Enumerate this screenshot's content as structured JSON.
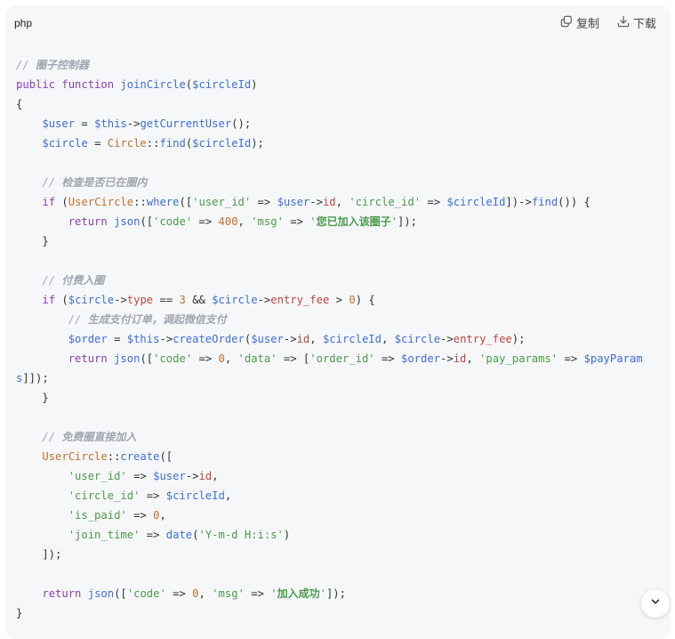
{
  "header": {
    "language": "php",
    "copy_label": "复制",
    "download_label": "下载"
  },
  "code": {
    "lines": [
      [
        [
          "cm",
          "// "
        ],
        [
          "czh",
          "圈子控制器"
        ]
      ],
      [
        [
          "kw",
          "public function "
        ],
        [
          "fn",
          "joinCircle"
        ],
        [
          "pl",
          "("
        ],
        [
          "vr",
          "$circleId"
        ],
        [
          "pl",
          ")"
        ]
      ],
      [
        [
          "pl",
          "{"
        ]
      ],
      [
        [
          "pl",
          "    "
        ],
        [
          "vr",
          "$user"
        ],
        [
          "pl",
          " = "
        ],
        [
          "vr",
          "$this"
        ],
        [
          "pl",
          "->"
        ],
        [
          "fn",
          "getCurrentUser"
        ],
        [
          "pl",
          "();"
        ]
      ],
      [
        [
          "pl",
          "    "
        ],
        [
          "vr",
          "$circle"
        ],
        [
          "pl",
          " = "
        ],
        [
          "cl",
          "Circle"
        ],
        [
          "pl",
          "::"
        ],
        [
          "fn",
          "find"
        ],
        [
          "pl",
          "("
        ],
        [
          "vr",
          "$circleId"
        ],
        [
          "pl",
          ");"
        ]
      ],
      [],
      [
        [
          "pl",
          "    "
        ],
        [
          "cm",
          "// "
        ],
        [
          "czh",
          "检查是否已在圈内"
        ]
      ],
      [
        [
          "pl",
          "    "
        ],
        [
          "kw",
          "if"
        ],
        [
          "pl",
          " ("
        ],
        [
          "cl",
          "UserCircle"
        ],
        [
          "pl",
          "::"
        ],
        [
          "fn",
          "where"
        ],
        [
          "pl",
          "(["
        ],
        [
          "st",
          "'user_id'"
        ],
        [
          "pl",
          " => "
        ],
        [
          "vr",
          "$user"
        ],
        [
          "pl",
          "->"
        ],
        [
          "pr",
          "id"
        ],
        [
          "pl",
          ", "
        ],
        [
          "st",
          "'circle_id'"
        ],
        [
          "pl",
          " => "
        ],
        [
          "vr",
          "$circleId"
        ],
        [
          "pl",
          "])->"
        ],
        [
          "fn",
          "find"
        ],
        [
          "pl",
          "()) {"
        ]
      ],
      [
        [
          "pl",
          "        "
        ],
        [
          "kw",
          "return "
        ],
        [
          "fn",
          "json"
        ],
        [
          "pl",
          "(["
        ],
        [
          "st",
          "'code'"
        ],
        [
          "pl",
          " => "
        ],
        [
          "nm",
          "400"
        ],
        [
          "pl",
          ", "
        ],
        [
          "st",
          "'msg'"
        ],
        [
          "pl",
          " => "
        ],
        [
          "st",
          "'"
        ],
        [
          "zh",
          "您已加入该圈子"
        ],
        [
          "st",
          "'"
        ],
        [
          "pl",
          "]);"
        ]
      ],
      [
        [
          "pl",
          "    }"
        ]
      ],
      [],
      [
        [
          "pl",
          "    "
        ],
        [
          "cm",
          "// "
        ],
        [
          "czh",
          "付费入圈"
        ]
      ],
      [
        [
          "pl",
          "    "
        ],
        [
          "kw",
          "if"
        ],
        [
          "pl",
          " ("
        ],
        [
          "vr",
          "$circle"
        ],
        [
          "pl",
          "->"
        ],
        [
          "pr",
          "type"
        ],
        [
          "pl",
          " == "
        ],
        [
          "nm",
          "3"
        ],
        [
          "pl",
          " && "
        ],
        [
          "vr",
          "$circle"
        ],
        [
          "pl",
          "->"
        ],
        [
          "pr",
          "entry_fee"
        ],
        [
          "pl",
          " > "
        ],
        [
          "nm",
          "0"
        ],
        [
          "pl",
          ") {"
        ]
      ],
      [
        [
          "pl",
          "        "
        ],
        [
          "cm",
          "// "
        ],
        [
          "czh",
          "生成支付订单，调起微信支付"
        ]
      ],
      [
        [
          "pl",
          "        "
        ],
        [
          "vr",
          "$order"
        ],
        [
          "pl",
          " = "
        ],
        [
          "vr",
          "$this"
        ],
        [
          "pl",
          "->"
        ],
        [
          "fn",
          "createOrder"
        ],
        [
          "pl",
          "("
        ],
        [
          "vr",
          "$user"
        ],
        [
          "pl",
          "->"
        ],
        [
          "pr",
          "id"
        ],
        [
          "pl",
          ", "
        ],
        [
          "vr",
          "$circleId"
        ],
        [
          "pl",
          ", "
        ],
        [
          "vr",
          "$circle"
        ],
        [
          "pl",
          "->"
        ],
        [
          "pr",
          "entry_fee"
        ],
        [
          "pl",
          ");"
        ]
      ],
      [
        [
          "pl",
          "        "
        ],
        [
          "kw",
          "return "
        ],
        [
          "fn",
          "json"
        ],
        [
          "pl",
          "(["
        ],
        [
          "st",
          "'code'"
        ],
        [
          "pl",
          " => "
        ],
        [
          "nm",
          "0"
        ],
        [
          "pl",
          ", "
        ],
        [
          "st",
          "'data'"
        ],
        [
          "pl",
          " => ["
        ],
        [
          "st",
          "'order_id'"
        ],
        [
          "pl",
          " => "
        ],
        [
          "vr",
          "$order"
        ],
        [
          "pl",
          "->"
        ],
        [
          "pr",
          "id"
        ],
        [
          "pl",
          ", "
        ],
        [
          "st",
          "'pay_params'"
        ],
        [
          "pl",
          " => "
        ],
        [
          "vr",
          "$payParam"
        ]
      ],
      [
        [
          "vr",
          "s"
        ],
        [
          "pl",
          "]]);"
        ]
      ],
      [
        [
          "pl",
          "    }"
        ]
      ],
      [],
      [
        [
          "pl",
          "    "
        ],
        [
          "cm",
          "// "
        ],
        [
          "czh",
          "免费圈直接加入"
        ]
      ],
      [
        [
          "pl",
          "    "
        ],
        [
          "cl",
          "UserCircle"
        ],
        [
          "pl",
          "::"
        ],
        [
          "fn",
          "create"
        ],
        [
          "pl",
          "(["
        ]
      ],
      [
        [
          "pl",
          "        "
        ],
        [
          "st",
          "'user_id'"
        ],
        [
          "pl",
          " => "
        ],
        [
          "vr",
          "$user"
        ],
        [
          "pl",
          "->"
        ],
        [
          "pr",
          "id"
        ],
        [
          "pl",
          ","
        ]
      ],
      [
        [
          "pl",
          "        "
        ],
        [
          "st",
          "'circle_id'"
        ],
        [
          "pl",
          " => "
        ],
        [
          "vr",
          "$circleId"
        ],
        [
          "pl",
          ","
        ]
      ],
      [
        [
          "pl",
          "        "
        ],
        [
          "st",
          "'is_paid'"
        ],
        [
          "pl",
          " => "
        ],
        [
          "nm",
          "0"
        ],
        [
          "pl",
          ","
        ]
      ],
      [
        [
          "pl",
          "        "
        ],
        [
          "st",
          "'join_time'"
        ],
        [
          "pl",
          " => "
        ],
        [
          "fn",
          "date"
        ],
        [
          "pl",
          "("
        ],
        [
          "st",
          "'Y-m-d H:i:s'"
        ],
        [
          "pl",
          ")"
        ]
      ],
      [
        [
          "pl",
          "    ]);"
        ]
      ],
      [],
      [
        [
          "pl",
          "    "
        ],
        [
          "kw",
          "return "
        ],
        [
          "fn",
          "json"
        ],
        [
          "pl",
          "(["
        ],
        [
          "st",
          "'code'"
        ],
        [
          "pl",
          " => "
        ],
        [
          "nm",
          "0"
        ],
        [
          "pl",
          ", "
        ],
        [
          "st",
          "'msg'"
        ],
        [
          "pl",
          " => "
        ],
        [
          "st",
          "'"
        ],
        [
          "zh",
          "加入成功"
        ],
        [
          "st",
          "'"
        ],
        [
          "pl",
          "]);"
        ]
      ],
      [
        [
          "pl",
          "}"
        ]
      ]
    ]
  },
  "icons": {
    "copy": "copy-icon",
    "download": "download-icon",
    "scroll": "chevron-down-icon"
  }
}
